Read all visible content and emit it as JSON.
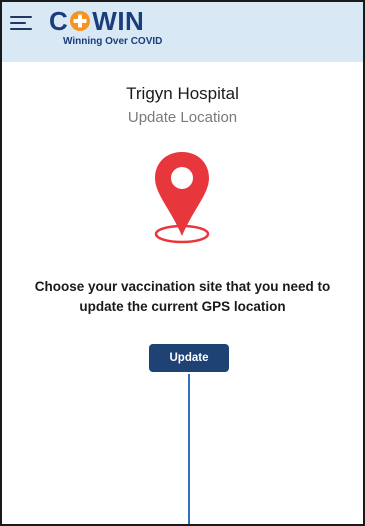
{
  "header": {
    "logo_text_before": "C",
    "logo_text_after": "WIN",
    "tagline": "Winning Over COVID",
    "menu_icon": "hamburger-menu-icon",
    "logo_icon": "medical-cross-icon",
    "colors": {
      "header_bg": "#d8e8f5",
      "logo_blue": "#1a3d7c",
      "cross_orange": "#f7941d"
    }
  },
  "main": {
    "hospital_name": "Trigyn Hospital",
    "subtitle": "Update Location",
    "location_icon": "location-pin-icon",
    "instruction": "Choose your vaccination site that you need to update the current GPS location",
    "update_button_label": "Update",
    "colors": {
      "pin_red": "#e8363d",
      "button_bg": "#1f4275",
      "pointer_line": "#2f6fbe"
    }
  }
}
